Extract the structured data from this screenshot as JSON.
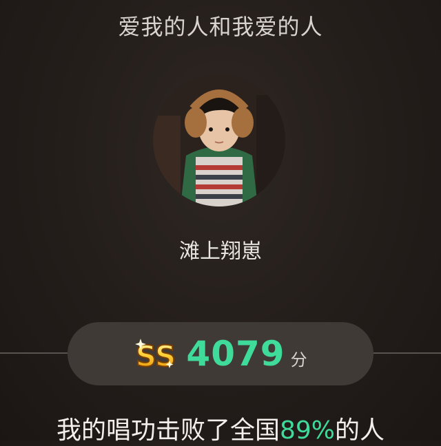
{
  "header": {
    "song_title": "爱我的人和我爱的人"
  },
  "profile": {
    "username": "滩上翔崽",
    "avatar_icon": "user-avatar-photo"
  },
  "score": {
    "grade": "SS",
    "value": "4079",
    "unit": "分",
    "accent_color": "#3fdb9a"
  },
  "summary": {
    "prefix": "我的唱功击败了全国",
    "percent": "89%",
    "suffix": "的人"
  }
}
